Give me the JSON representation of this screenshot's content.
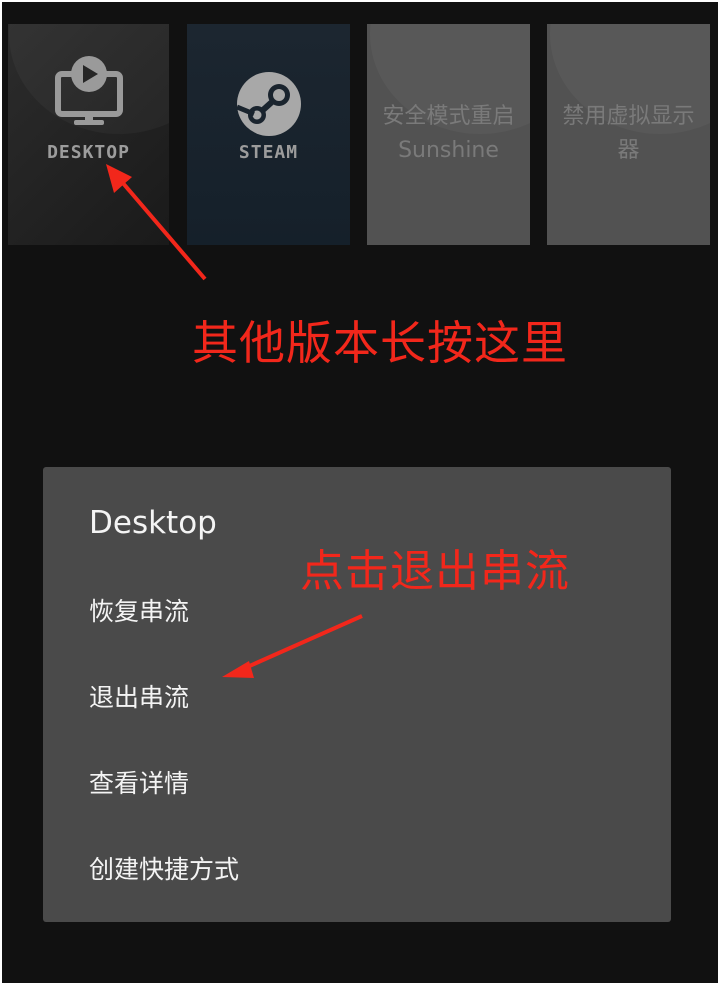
{
  "tiles": [
    {
      "label": "DESKTOP",
      "icon": "monitor-play-icon"
    },
    {
      "label": "STEAM",
      "icon": "steam-logo-icon"
    },
    {
      "label": "安全模式重启Sunshine"
    },
    {
      "label": "禁用虚拟显示器"
    }
  ],
  "annotations": {
    "long_press": "其他版本长按这里",
    "click_exit": "点击退出串流"
  },
  "dialog": {
    "title": "Desktop",
    "items": [
      "恢复串流",
      "退出串流",
      "查看详情",
      "创建快捷方式"
    ]
  },
  "colors": {
    "background": "#111111",
    "dialog": "#4a4a4a",
    "annotation": "#f2271b",
    "tile_disabled": "#525252"
  }
}
